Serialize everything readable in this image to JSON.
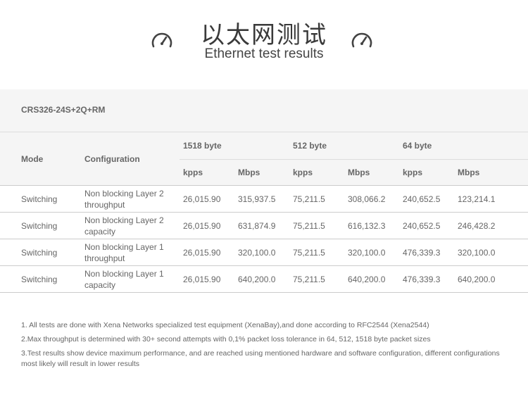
{
  "header": {
    "title_cn": "以太网测试",
    "title_en": "Ethernet test results",
    "icons": [
      "gauge-icon",
      "gauge-icon"
    ]
  },
  "model": "CRS326-24S+2Q+RM",
  "table": {
    "headers": {
      "mode": "Mode",
      "configuration": "Configuration",
      "groups": [
        "1518 byte",
        "512 byte",
        "64 byte"
      ],
      "sub": [
        "kpps",
        "Mbps",
        "kpps",
        "Mbps",
        "kpps",
        "Mbps"
      ]
    },
    "rows": [
      {
        "mode": "Switching",
        "config": "Non blocking Layer 2 throughput",
        "values": [
          "26,015.90",
          "315,937.5",
          "75,211.5",
          "308,066.2",
          "240,652.5",
          "123,214.1"
        ]
      },
      {
        "mode": "Switching",
        "config": "Non blocking Layer 2 capacity",
        "values": [
          "26,015.90",
          "631,874.9",
          "75,211.5",
          "616,132.3",
          "240,652.5",
          "246,428.2"
        ]
      },
      {
        "mode": "Switching",
        "config": "Non blocking Layer 1 throughput",
        "values": [
          "26,015.90",
          "320,100.0",
          "75,211.5",
          "320,100.0",
          "476,339.3",
          "320,100.0"
        ]
      },
      {
        "mode": "Switching",
        "config": "Non blocking Layer 1 capacity",
        "values": [
          "26,015.90",
          "640,200.0",
          "75,211.5",
          "640,200.0",
          "476,339.3",
          "640,200.0"
        ]
      }
    ]
  },
  "notes": [
    "1. All tests are done with Xena Networks specialized test equipment (XenaBay),and done according to RFC2544 (Xena2544)",
    "2.Max throughput is determined with 30+ second attempts with 0,1% packet loss tolerance in 64, 512, 1518 byte packet sizes",
    "3.Test results show device maximum performance, and are reached using mentioned hardware and software configuration, different configurations most likely will result in lower results"
  ]
}
